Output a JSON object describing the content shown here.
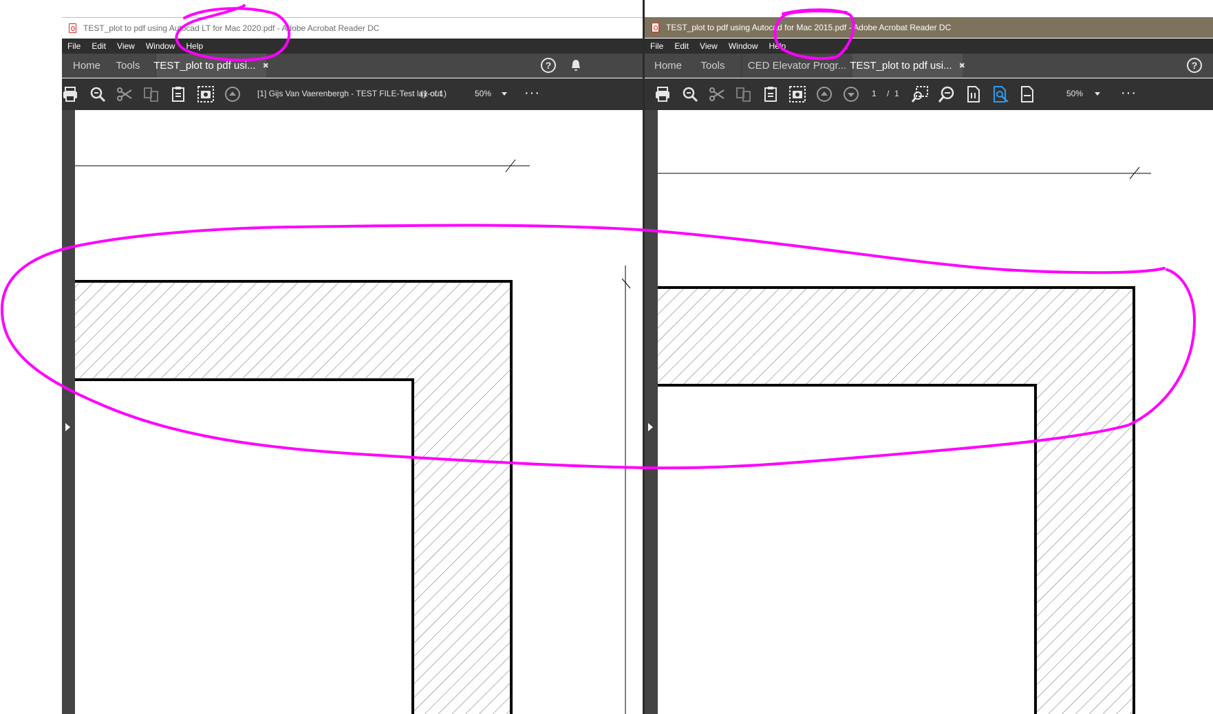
{
  "left_window": {
    "title": "TEST_plot to pdf using Autocad LT for Mac 2020.pdf - Adobe Acrobat Reader DC",
    "menu": [
      "File",
      "Edit",
      "View",
      "Window",
      "Help"
    ],
    "tabs": {
      "home": "Home",
      "tools": "Tools",
      "document": "TEST_plot to pdf usi...",
      "close": "✖"
    },
    "toolbar": {
      "icons": [
        "print-icon",
        "zoom-search-icon",
        "scissors-icon",
        "compare-icon",
        "clipboard-icon",
        "snapshot-icon",
        "stamp-icon"
      ],
      "page_label": "[1] Gijs Van Vaerenbergh - TEST FILE-Test lay-out",
      "page_count": "(1 of 1)",
      "zoom": "50%",
      "more": "···"
    },
    "help": "?"
  },
  "right_window": {
    "title": "TEST_plot to pdf using Autocad for Mac 2015.pdf - Adobe Acrobat Reader DC",
    "menu": [
      "File",
      "Edit",
      "View",
      "Window",
      "Help"
    ],
    "tabs": {
      "home": "Home",
      "tools": "Tools",
      "other_document": "CED Elevator Progr...",
      "document": "TEST_plot to pdf usi...",
      "close": "✖"
    },
    "toolbar": {
      "icons": [
        "print-icon",
        "zoom-search-icon",
        "scissors-icon",
        "compare-icon",
        "clipboard-icon",
        "snapshot-icon",
        "stamp-icon",
        "stamp-down-icon",
        "select-zoom-icon",
        "zoom-out-icon",
        "actual-size-icon",
        "find-icon",
        "fit-width-icon"
      ],
      "current_page": "1",
      "page_sep": "/",
      "total_pages": "1",
      "zoom": "50%",
      "more": "···"
    },
    "help": "?"
  },
  "annotation_color": "#ff00ff",
  "accent_blue": "#2d9bf0"
}
